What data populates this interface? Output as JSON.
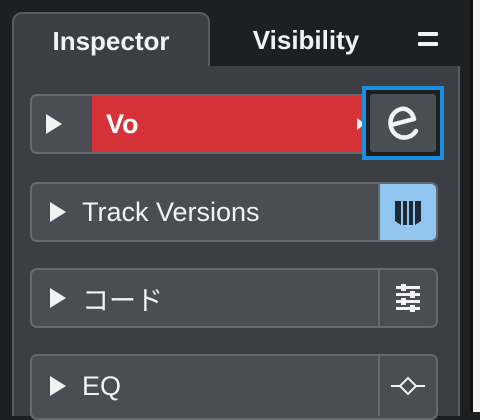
{
  "tabs": {
    "inspector": "Inspector",
    "visibility": "Visibility"
  },
  "track": {
    "name": "Vo",
    "color": "#d53338",
    "edit_icon": "e-icon"
  },
  "sections": [
    {
      "label": "Track Versions",
      "button_icon": "track-versions-icon",
      "button_active": true
    },
    {
      "label": "コード",
      "button_icon": "chord-track-icon",
      "button_active": false
    },
    {
      "label": "EQ",
      "button_icon": "eq-curve-icon",
      "button_active": false
    }
  ],
  "colors": {
    "accent_highlight": "#1b8fe0",
    "active_button": "#8fc5ef"
  }
}
